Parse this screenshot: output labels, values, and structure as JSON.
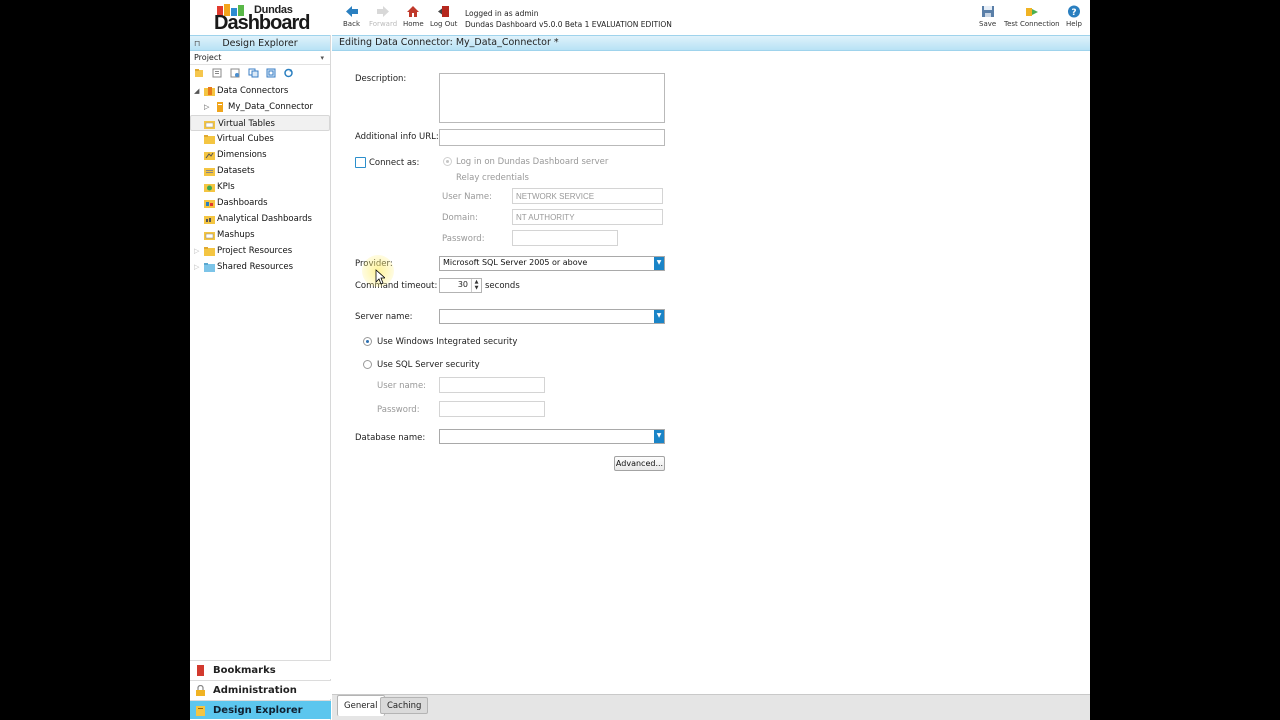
{
  "logo": {
    "small_text": "Dundas",
    "big_text": "Dashboard"
  },
  "toolbar": {
    "back": "Back",
    "forward": "Forward",
    "home": "Home",
    "logout": "Log Out",
    "save": "Save",
    "test_connection": "Test Connection",
    "help": "Help",
    "login_line1": "Logged in as admin",
    "login_line2": "Dundas Dashboard v5.0.0 Beta 1 EVALUATION EDITION"
  },
  "left_panel": {
    "title": "Design Explorer",
    "project_label": "Project",
    "tree": [
      {
        "label": "Data Connectors",
        "expanded": true
      },
      {
        "label": "My_Data_Connector"
      },
      {
        "label": "Virtual Tables",
        "selected": true
      },
      {
        "label": "Virtual Cubes"
      },
      {
        "label": "Dimensions"
      },
      {
        "label": "Datasets"
      },
      {
        "label": "KPIs"
      },
      {
        "label": "Dashboards"
      },
      {
        "label": "Analytical Dashboards"
      },
      {
        "label": "Mashups"
      },
      {
        "label": "Project Resources"
      },
      {
        "label": "Shared Resources"
      }
    ],
    "bottom": {
      "bookmarks": "Bookmarks",
      "administration": "Administration",
      "design_explorer": "Design Explorer"
    }
  },
  "main": {
    "title": "Editing Data Connector: My_Data_Connector *",
    "form": {
      "description_label": "Description:",
      "description_value": "",
      "additional_info_label": "Additional info URL:",
      "additional_info_value": "",
      "connect_as_label": "Connect as:",
      "connect_as_checked": false,
      "login_option": "Log in on Dundas Dashboard server",
      "relay_option": "Relay credentials",
      "user_name_label": "User Name:",
      "user_name_value": "NETWORK SERVICE",
      "domain_label": "Domain:",
      "domain_value": "NT AUTHORITY",
      "password_label": "Password:",
      "provider_label": "Provider:",
      "provider_value": "Microsoft SQL Server 2005 or above",
      "command_timeout_label": "Command timeout:",
      "command_timeout_value": "30",
      "seconds_label": "seconds",
      "server_name_label": "Server name:",
      "server_name_value": "",
      "windows_security_label": "Use Windows Integrated security",
      "sql_security_label": "Use SQL Server security",
      "sql_user_label": "User name:",
      "sql_password_label": "Password:",
      "database_name_label": "Database name:",
      "database_name_value": "",
      "advanced_button": "Advanced..."
    },
    "tabs": [
      {
        "label": "General",
        "active": true
      },
      {
        "label": "Caching",
        "active": false
      }
    ]
  },
  "colors": {
    "header_gradient_top": "#dff2fb",
    "header_gradient_bottom": "#b8e2f5",
    "active_nav": "#5cc6ee",
    "combo_button": "#1a84c7"
  }
}
